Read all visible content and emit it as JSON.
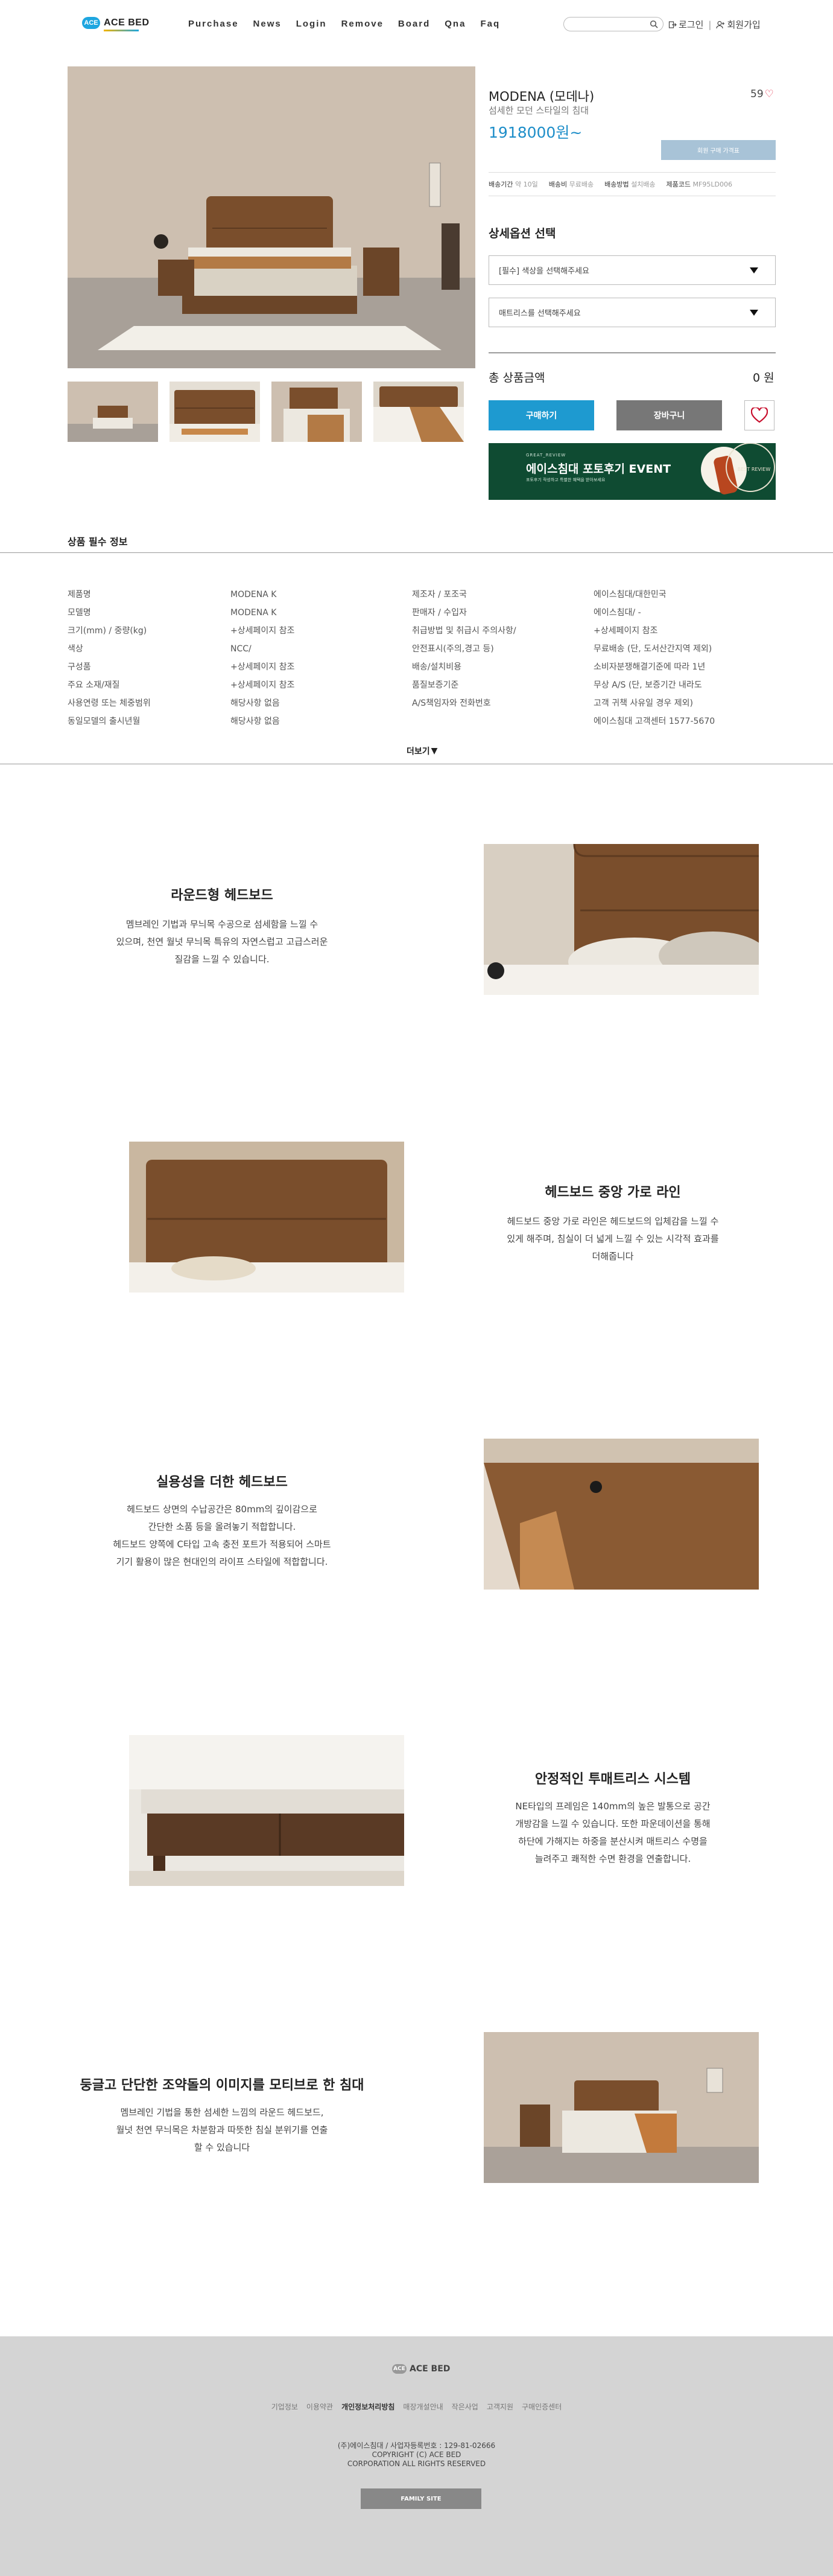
{
  "header": {
    "logo_badge": "ACE",
    "logo_word": "ACE BED",
    "nav": [
      "Purchase",
      "News",
      "Login",
      "Remove",
      "Board",
      "Qna",
      "Faq"
    ],
    "search_placeholder": "",
    "login": "로그인",
    "signup": "회원가입"
  },
  "product": {
    "name": "MODENA (모데나)",
    "subtitle": "섬세한 모던 스타일의 침대",
    "price": "1918000원~",
    "likes": "59",
    "member_price_btn": "회원 구매 가격표",
    "shipping": [
      {
        "label": "배송기간",
        "value": "약 10일"
      },
      {
        "label": "배송비",
        "value": "무료배송"
      },
      {
        "label": "배송방법",
        "value": "설치배송"
      },
      {
        "label": "제품코드",
        "value": "MF95LD006"
      }
    ],
    "option_title": "상세옵션 선택",
    "options": [
      "[필수] 색상을 선택해주세요",
      "매트리스를 선택해주세요"
    ],
    "total_label": "총 상품금액",
    "total_value": "0 원",
    "buy": "구매하기",
    "cart": "장바구니",
    "banner": {
      "small": "GREAT_REVIEW",
      "big": "에이스침대 포토후기 EVENT",
      "tiny": "포토후기 작성하고 특별한 혜택을 받아보세요",
      "circle": "BEST REVIEW"
    }
  },
  "info": {
    "title": "상품 필수 정보",
    "cols": [
      [
        "제품명",
        "모델명",
        "크기(mm) / 중량(kg)",
        "색상",
        "구성품",
        "주요 소재/재질",
        "사용연령 또는 체중범위",
        "동일모델의 출시년월"
      ],
      [
        "MODENA K",
        "MODENA K",
        "+상세페이지 참조",
        "NCC/",
        "+상세페이지 참조",
        "+상세페이지 참조",
        "해당사항 없음",
        "해당사항 없음"
      ],
      [
        "제조자 / 포조국",
        "판매자 / 수입자",
        "취급방법 및 취급시 주의사항/",
        "안전표시(주의,경고 등)",
        "배송/설치비용",
        "품질보증기준",
        "A/S책임자와 전화번호",
        ""
      ],
      [
        "에이스침대/대한민국",
        "에이스침대/ -",
        "+상세페이지 참조",
        "무료배송 (단, 도서산간지역 제외)",
        "소비자분쟁해결기준에 따라 1년",
        "무상 A/S (단, 보증기간 내라도",
        "고객 귀책 사유일 경우 제외)",
        "에이스침대 고객센터 1577-5670"
      ]
    ],
    "more": "더보기"
  },
  "features": [
    {
      "title": "라운드형 헤드보드",
      "desc": [
        "멤브레인 기법과 무늬목 수공으로 섬세함을 느낄 수",
        "있으며, 천연 월넛 무늬목 특유의 자연스럽고 고급스러운",
        "질감을 느낄 수 있습니다."
      ]
    },
    {
      "title": "헤드보드 중앙 가로 라인",
      "desc": [
        "헤드보드 중앙 가로 라인은 헤드보드의 입체감을 느낄 수",
        "있게 해주며, 침실이 더 넓게 느낄 수 있는 시각적 효과를",
        "더해줍니다"
      ]
    },
    {
      "title": "실용성을 더한 헤드보드",
      "desc": [
        "헤드보드 상면의 수납공간은 80mm의 깊이감으로",
        "간단한 소품 등을 올려놓기 적합합니다.",
        "헤드보드 양쪽에 C타입 고속 충전 포트가 적용되어 스마트",
        "기기 활용이 많은 현대인의 라이프 스타일에 적합합니다."
      ]
    },
    {
      "title": "안정적인 투매트리스 시스템",
      "desc": [
        "NE타입의 프레임은 140mm의 높은 발통으로 공간",
        "개방감을 느낄 수 있습니다. 또한 파운데이션을 통해",
        "하단에 가해지는 하중을 분산시켜 매트리스 수명을",
        "늘려주고 쾌적한 수면 환경을 연출합니다."
      ]
    },
    {
      "title": "둥글고 단단한 조약돌의 이미지를 모티브로 한 침대",
      "desc": [
        "멤브레인 기법을 통한 섬세한 느낌의 라운드 헤드보드,",
        "월넛 천연 무늬목은 차분함과 따뜻한 침실 분위기를 연출",
        "할 수 있습니다"
      ]
    }
  ],
  "footer": {
    "logo_badge": "ACE",
    "logo_word": "ACE BED",
    "links": [
      "기업정보",
      "이용약관",
      "개인정보처리방침",
      "매장개설안내",
      "작은사업",
      "고객지원",
      "구매인증센터"
    ],
    "company": "(주)에이스침대 / 사업자등록번호 : 129-81-02666",
    "copyright1": "COPYRIGHT (C) ACE BED",
    "copyright2": "CORPORATION ALL RIGHTS RESERVED",
    "family": "FAMILY SITE"
  },
  "colors": {
    "accent": "#1e9ad0",
    "price": "#1e8ec9",
    "heart": "#e3344e",
    "banner": "#0f4b32",
    "footer": "#d4d4d4"
  }
}
